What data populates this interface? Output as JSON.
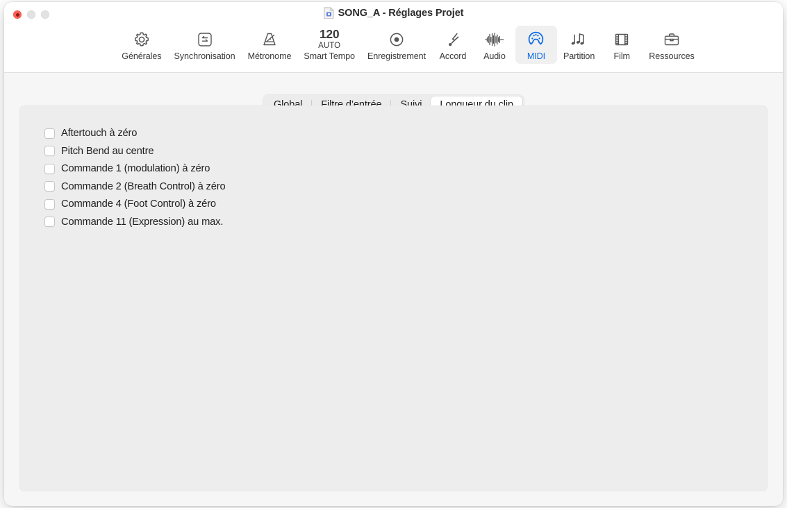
{
  "window": {
    "title": "SONG_A - Réglages Projet",
    "doc_icon": "document-icon",
    "traffic_lights": {
      "close": "close-button",
      "minimize": "minimize-button",
      "maximize": "maximize-button"
    }
  },
  "toolbar": {
    "items": [
      {
        "label": "Générales",
        "icon": "gear-icon",
        "selected": false
      },
      {
        "label": "Synchronisation",
        "icon": "sync-icon",
        "selected": false
      },
      {
        "label": "Métronome",
        "icon": "metronome-icon",
        "selected": false
      },
      {
        "label": "Smart Tempo",
        "icon": "tempo-icon",
        "selected": false,
        "tempo_value": "120",
        "tempo_mode": "AUTO"
      },
      {
        "label": "Enregistrement",
        "icon": "record-icon",
        "selected": false
      },
      {
        "label": "Accord",
        "icon": "tuning-fork-icon",
        "selected": false
      },
      {
        "label": "Audio",
        "icon": "waveform-icon",
        "selected": false
      },
      {
        "label": "MIDI",
        "icon": "midi-port-icon",
        "selected": true
      },
      {
        "label": "Partition",
        "icon": "music-notes-icon",
        "selected": false
      },
      {
        "label": "Film",
        "icon": "film-strip-icon",
        "selected": false
      },
      {
        "label": "Ressources",
        "icon": "briefcase-icon",
        "selected": false
      }
    ]
  },
  "tabs": [
    {
      "label": "Global",
      "selected": false
    },
    {
      "label": "Filtre d’entrée",
      "selected": false
    },
    {
      "label": "Suivi",
      "selected": false
    },
    {
      "label": "Longueur du clip",
      "selected": true
    }
  ],
  "panel": {
    "checkboxes": [
      {
        "label": "Aftertouch à zéro",
        "checked": false
      },
      {
        "label": "Pitch Bend au centre",
        "checked": false
      },
      {
        "label": "Commande 1 (modulation) à zéro",
        "checked": false
      },
      {
        "label": "Commande 2 (Breath Control) à zéro",
        "checked": false
      },
      {
        "label": "Commande 4 (Foot Control) à zéro",
        "checked": false
      },
      {
        "label": "Commande 11 (Expression) au max.",
        "checked": false
      }
    ]
  },
  "colors": {
    "accent": "#0a6ae4",
    "close": "#ff5f57",
    "window_bg": "#f6f6f6",
    "panel_bg": "#ededed",
    "toolbar_bg": "#ffffff",
    "text": "#1d1d1f"
  }
}
